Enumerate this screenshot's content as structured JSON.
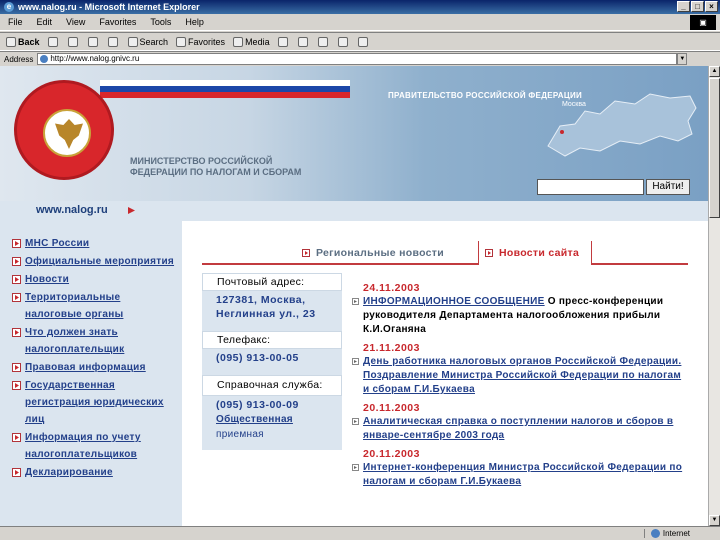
{
  "window": {
    "title": "www.nalog.ru - Microsoft Internet Explorer",
    "btn_min": "_",
    "btn_max": "□",
    "btn_close": "×"
  },
  "menu": [
    "File",
    "Edit",
    "View",
    "Favorites",
    "Tools",
    "Help"
  ],
  "toolbar": {
    "back": "Back",
    "search": "Search",
    "favorites": "Favorites",
    "media": "Media"
  },
  "address": {
    "label": "Address",
    "url": "http://www.nalog.gnivc.ru"
  },
  "status": {
    "zone": "Internet"
  },
  "header": {
    "gov": "ПРАВИТЕЛЬСТВО РОССИЙСКОЙ ФЕДЕРАЦИИ",
    "moscow": "Москва",
    "ministry_line1": "МИНИСТЕРСТВО РОССИЙСКОЙ",
    "ministry_line2": "ФЕДЕРАЦИИ ПО НАЛОГАМ И СБОРАМ",
    "search_button": "Найти!",
    "site_url": "www.nalog.ru"
  },
  "nav": [
    "МНС России",
    "Официальные мероприятия",
    "Новости",
    "Территориальные налоговые органы",
    "Что должен знать налогоплательщик",
    "Правовая информация",
    "Государственная регистрация юридических лиц",
    "Информация по учету налогоплательщиков",
    "Декларирование"
  ],
  "tabs": {
    "regional": "Региональные новости",
    "site": "Новости сайта"
  },
  "info": {
    "postal_label": "Почтовый адрес:",
    "postal_value": "127381, Москва, Неглинная ул., 23",
    "fax_label": "Телефакс:",
    "fax_value": "(095) 913-00-05",
    "help_label": "Справочная служба:",
    "help_phone": "(095) 913-00-09",
    "help_link": "Общественная",
    "help_rest": "приемная"
  },
  "news": [
    {
      "date": "24.11.2003",
      "link": "ИНФОРМАЦИОННОЕ СООБЩЕНИЕ",
      "text": " О пресс-конференции руководителя Департамента налогообложения прибыли К.И.Оганяна"
    },
    {
      "date": "21.11.2003",
      "link": "День работника налоговых органов Российской Федерации. Поздравление Министра Российской Федерации по налогам и сборам Г.И.Букаева",
      "text": ""
    },
    {
      "date": "20.11.2003",
      "link": "Аналитическая справка о поступлении налогов и сборов в январе-сентябре 2003 года",
      "text": ""
    },
    {
      "date": "20.11.2003",
      "link": "Интернет-конференция Министра Российской Федерации по налогам и сборам Г.И.Букаева",
      "text": ""
    }
  ]
}
